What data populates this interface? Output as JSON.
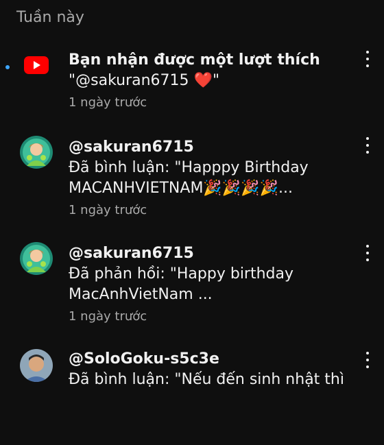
{
  "section_title": "Tuần này",
  "icons": {
    "youtube": "youtube-logo-icon",
    "more": "more-vertical-icon",
    "heart": "heart-emoji",
    "party": "party-popper-emoji"
  },
  "colors": {
    "background": "#0f0f0f",
    "text": "#f1f1f1",
    "secondary_text": "#aaaaaa",
    "unread_dot": "#3ea6ff",
    "youtube_red": "#ff0000"
  },
  "notifications": [
    {
      "title": "Bạn nhận được một lượt thích",
      "body_line1_prefix": "\"@sakuran6715 ",
      "heart": "❤️",
      "body_line1_suffix": "\"",
      "time": "1 ngày trước",
      "unread": true
    },
    {
      "title": "@sakuran6715",
      "body_line1": "Đã bình luận: \"Happpy Birthday",
      "body_line2": "MACANHVIETNAM🎉🎉🎉🎉...",
      "time": "1 ngày trước"
    },
    {
      "title": "@sakuran6715",
      "body_line1": "Đã phản hồi: \"Happy birthday",
      "body_line2": "MacAnhVietNam ...",
      "time": "1 ngày trước"
    },
    {
      "title": "@SoloGoku-s5c3e",
      "body_line1": "Đã bình luận: \"Nếu đến sinh nhật thì"
    }
  ]
}
